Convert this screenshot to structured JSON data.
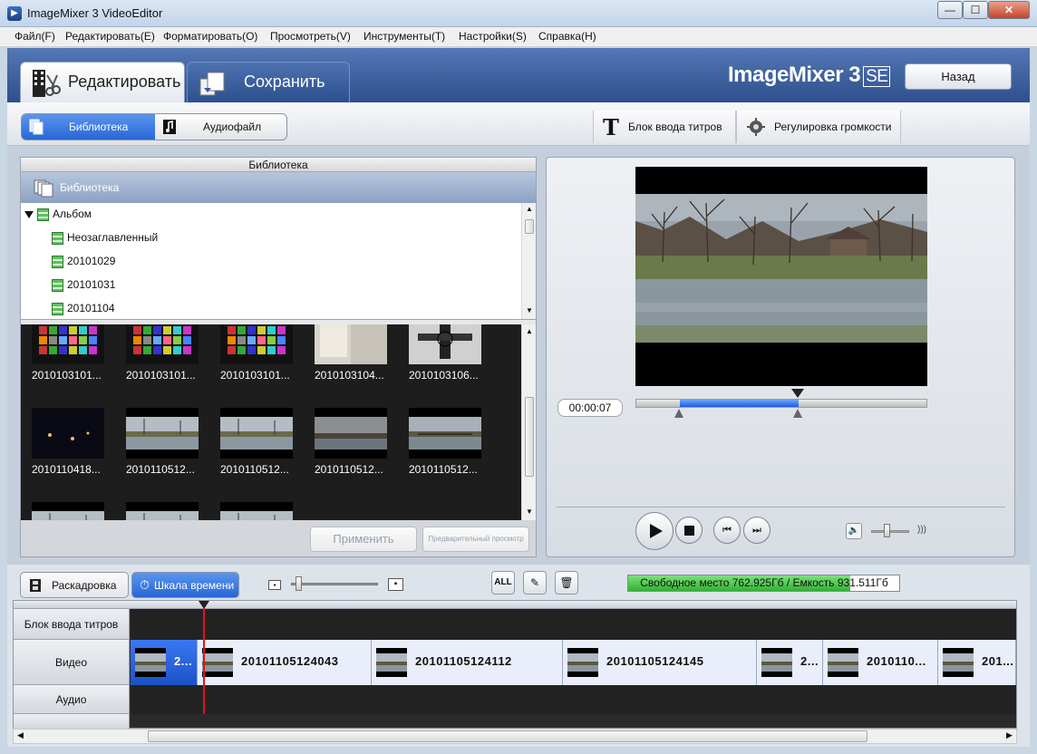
{
  "window": {
    "title": "ImageMixer 3 VideoEditor",
    "app_icon": "app-icon",
    "minimize": "—",
    "maximize": "☐",
    "close": "✕"
  },
  "menu": [
    "Файл(F)",
    "Редактировать(E)",
    "Форматировать(O)",
    "Просмотреть(V)",
    "Инструменты(T)",
    "Настройки(S)",
    "Справка(H)"
  ],
  "header": {
    "tabs": [
      {
        "label": "Редактировать",
        "icon": "film-scissors-icon"
      },
      {
        "label": "Сохранить",
        "icon": "save-document-icon"
      }
    ],
    "brand": "ImageMixer 3",
    "brand_suffix": "SE",
    "back_label": "Назад"
  },
  "toolbar": {
    "library_label": "Библиотека",
    "audio_label": "Аудиофайл",
    "title_block_label": "Блок ввода титров",
    "volume_label": "Регулировка громкости"
  },
  "library": {
    "header": "Библиотека",
    "bar_label": "Библиотека",
    "tree": [
      {
        "label": "Альбом",
        "level": 0,
        "expanded": true
      },
      {
        "label": "Неозаглавленный",
        "level": 1
      },
      {
        "label": "20101029",
        "level": 1
      },
      {
        "label": "20101031",
        "level": 1
      },
      {
        "label": "20101104",
        "level": 1
      }
    ],
    "thumbnails": [
      {
        "label": "2010103101...",
        "kind": "chart"
      },
      {
        "label": "2010103101...",
        "kind": "chart"
      },
      {
        "label": "2010103101...",
        "kind": "chart"
      },
      {
        "label": "2010103104...",
        "kind": "room"
      },
      {
        "label": "2010103106...",
        "kind": "testchart"
      },
      {
        "label": "2010110418...",
        "kind": "night"
      },
      {
        "label": "2010110512...",
        "kind": "river"
      },
      {
        "label": "2010110512...",
        "kind": "river"
      },
      {
        "label": "2010110512...",
        "kind": "dusk"
      },
      {
        "label": "2010110512...",
        "kind": "bridge"
      },
      {
        "label": "",
        "kind": "river"
      },
      {
        "label": "",
        "kind": "river"
      },
      {
        "label": "",
        "kind": "river"
      }
    ],
    "apply_label": "Применить",
    "preview_label": "Предварительный просмотр"
  },
  "preview": {
    "timecode": "00:00:07",
    "trim_start": 0.15,
    "trim_end": 0.56,
    "playhead": 0.56,
    "volume_level": 0.4,
    "volume_max_icon": "speaker-waves-icon"
  },
  "bottom": {
    "storyboard_label": "Раскадровка",
    "timeline_label": "Шкала времени",
    "zoom_level": 0.02,
    "all_label": "ALL",
    "free_space": "Свободное место 762.925Гб / Емкость 931.511Гб",
    "free_fraction": 0.82
  },
  "timeline": {
    "tracks": [
      "Блок ввода титров",
      "Видео",
      "Аудио"
    ],
    "clips": [
      {
        "label": "2...",
        "selected": true,
        "kind": "river"
      },
      {
        "label": "20101105124043",
        "selected": false,
        "kind": "river"
      },
      {
        "label": "20101105124112",
        "selected": false,
        "kind": "dusk"
      },
      {
        "label": "20101105124145",
        "selected": false,
        "kind": "bridge"
      },
      {
        "label": "2...",
        "selected": false,
        "kind": "river"
      },
      {
        "label": "2010110...",
        "selected": false,
        "kind": "river"
      },
      {
        "label": "201...",
        "selected": false,
        "kind": "river"
      }
    ]
  },
  "colors": {
    "accent": "#2866d6",
    "header": "#3a5c9c",
    "free_bar": "#2fb32f",
    "playhead": "#e0141e"
  }
}
